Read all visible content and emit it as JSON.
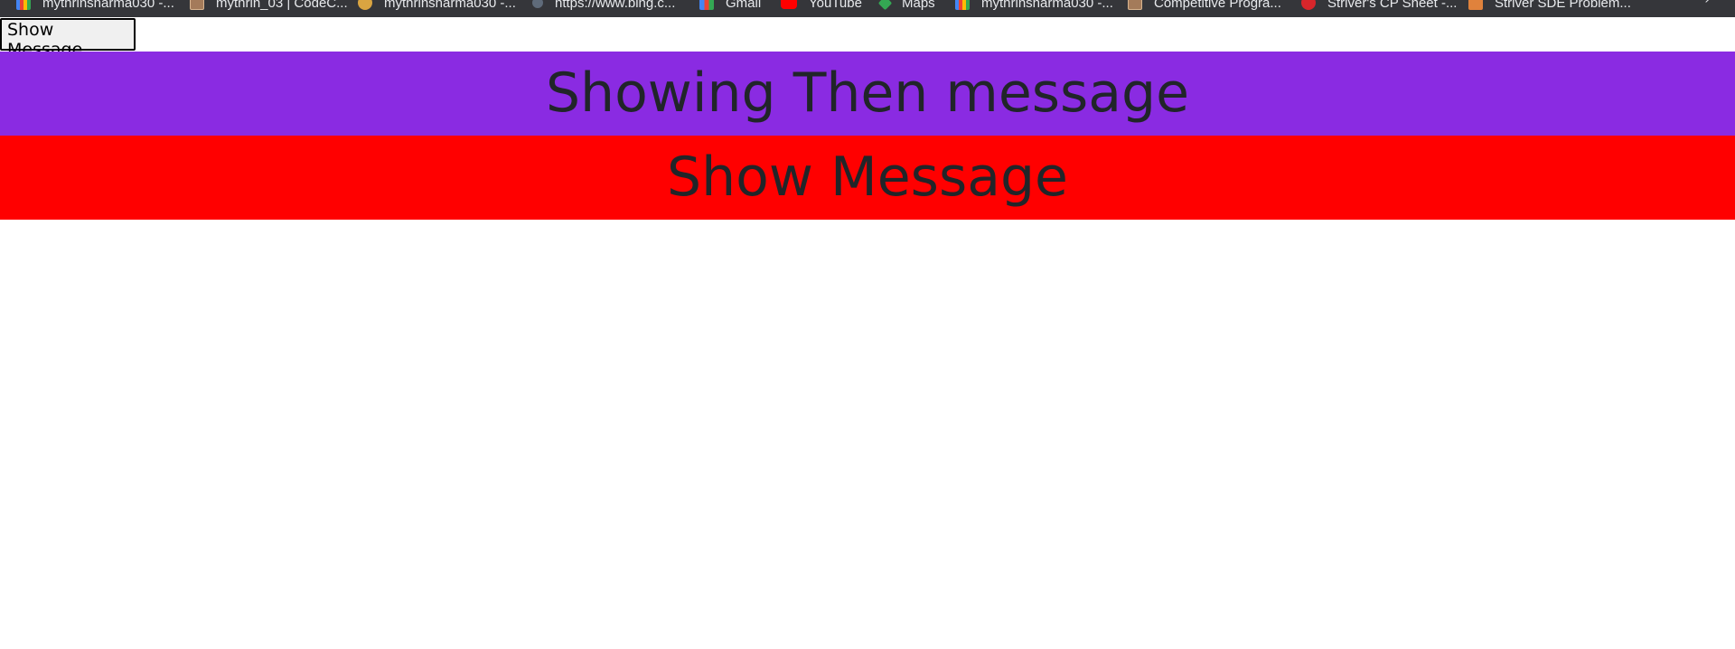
{
  "bookmarks": [
    {
      "label": "mythrinsharma030 -...",
      "icon": "google-icon"
    },
    {
      "label": "mythrin_03 | CodeC...",
      "icon": "codechef-icon"
    },
    {
      "label": "mythrinsharma030 -...",
      "icon": "avatar-icon"
    },
    {
      "label": "https://www.bing.c...",
      "icon": "search-icon"
    },
    {
      "label": "Gmail",
      "icon": "gmail-icon"
    },
    {
      "label": "YouTube",
      "icon": "youtube-icon"
    },
    {
      "label": "Maps",
      "icon": "maps-icon"
    },
    {
      "label": "mythrinsharma030 -...",
      "icon": "google-icon"
    },
    {
      "label": "Competitive Progra...",
      "icon": "box-icon"
    },
    {
      "label": "Striver's CP Sheet -...",
      "icon": "red-circle-icon"
    },
    {
      "label": "Striver SDE Problem...",
      "icon": "orange-box-icon"
    }
  ],
  "overflow_glyph": "›",
  "button": {
    "label": "Show Message"
  },
  "banners": {
    "purple": {
      "text": "Showing Then message",
      "color": "#8a2be2"
    },
    "red": {
      "text": "Show Message",
      "color": "#ff0000"
    }
  }
}
